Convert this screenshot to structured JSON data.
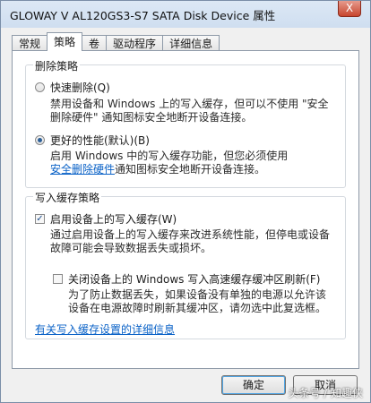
{
  "window": {
    "title": "GLOWAY V AL120GS3-S7 SATA Disk Device 属性",
    "close_label": "X"
  },
  "tabs": [
    {
      "label": "常规"
    },
    {
      "label": "策略"
    },
    {
      "label": "卷"
    },
    {
      "label": "驱动程序"
    },
    {
      "label": "详细信息"
    }
  ],
  "active_tab": "策略",
  "removal_policy": {
    "legend": "删除策略",
    "quick_removal": {
      "label": "快速删除(Q)",
      "selected": false,
      "desc_line1": "禁用设备和 Windows 上的写入缓存，但可以不使用 \"安全",
      "desc_line2": "删除硬件\" 通知图标安全地断开设备连接。"
    },
    "better_performance": {
      "label": "更好的性能(默认)(B)",
      "selected": true,
      "desc_line1": "启用 Windows 中的写入缓存功能，但您必须使用",
      "desc_link": "安全删除硬件",
      "desc_line2_rest": "通知图标安全地断开设备连接。"
    }
  },
  "write_cache_policy": {
    "legend": "写入缓存策略",
    "enable_cache": {
      "label": "启用设备上的写入缓存(W)",
      "checked": true,
      "desc_line1": "通过启用设备上的写入缓存来改进系统性能，但停电或设备",
      "desc_line2": "故障可能会导致数据丢失或损坏。"
    },
    "turn_off_flushing": {
      "label": "关闭设备上的 Windows 写入高速缓存缓冲区刷新(F)",
      "checked": false,
      "desc_line1": "为了防止数据丢失，如果设备没有单独的电源以允许该",
      "desc_line2": "设备在电源故障时刷新其缓冲区，请勿选中此复选框。"
    }
  },
  "details_link": "有关写入缓存设置的详细信息",
  "buttons": {
    "ok": "确定",
    "cancel": "取消"
  },
  "watermark": "头条号 / 知趣侠"
}
